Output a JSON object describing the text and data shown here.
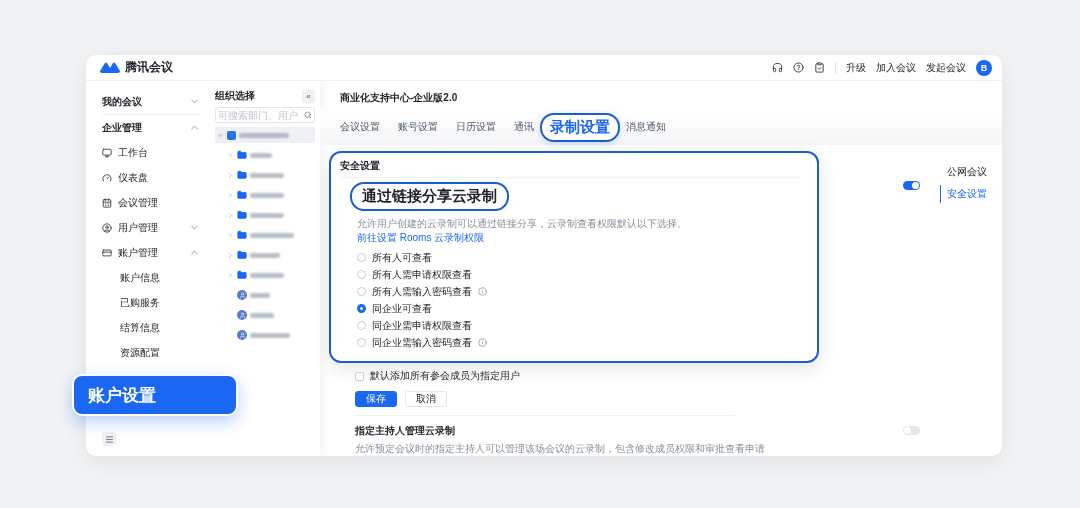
{
  "app": {
    "name": "腾讯会议"
  },
  "header": {
    "actions": [
      "升级",
      "加入会议",
      "发起会议"
    ],
    "avatar": "B"
  },
  "sidebar": {
    "items": [
      {
        "label": "我的会议",
        "expanded": false
      },
      {
        "label": "企业管理",
        "expanded": true,
        "children": [
          {
            "label": "工作台"
          },
          {
            "label": "仪表盘"
          },
          {
            "label": "会议管理"
          },
          {
            "label": "用户管理",
            "expanded": false
          },
          {
            "label": "账户管理",
            "expanded": true,
            "children": [
              {
                "label": "账户信息"
              },
              {
                "label": "已购服务"
              },
              {
                "label": "结算信息"
              },
              {
                "label": "资源配置"
              }
            ]
          }
        ]
      }
    ]
  },
  "org_panel": {
    "title": "组织选择",
    "collapse": "«",
    "search": {
      "placeholder": "可搜索部门、用户"
    },
    "tree": {
      "expanded": true,
      "selected": true,
      "children": [
        {
          "kind": "folder",
          "expanded": false
        },
        {
          "kind": "folder",
          "expanded": false
        },
        {
          "kind": "folder",
          "expanded": false
        },
        {
          "kind": "folder",
          "expanded": false
        },
        {
          "kind": "folder",
          "expanded": false
        },
        {
          "kind": "folder",
          "expanded": false
        },
        {
          "kind": "folder",
          "expanded": false
        },
        {
          "kind": "person"
        },
        {
          "kind": "person"
        },
        {
          "kind": "person"
        }
      ]
    }
  },
  "callout": {
    "label": "账户设置"
  },
  "main": {
    "title": "商业化支持中心-企业版2.0",
    "tabs": [
      {
        "label": "会议设置",
        "selected": false
      },
      {
        "label": "账号设置",
        "selected": false
      },
      {
        "label": "日历设置",
        "selected": false
      },
      {
        "label": "通讯",
        "selected": false
      },
      {
        "label": "录制设置",
        "selected": true
      },
      {
        "label": "消息通知",
        "selected": false
      }
    ],
    "section": {
      "title": "安全设置",
      "setting": {
        "title": "通过链接分享云录制",
        "on": true,
        "description": "允许用户创建的云录制可以通过链接分享，云录制查看权限默认以下选择。",
        "link": "前往设置 Rooms 云录制权限",
        "options": [
          {
            "label": "所有人可查看",
            "selected": false,
            "info": false
          },
          {
            "label": "所有人需申请权限查看",
            "selected": false,
            "info": false
          },
          {
            "label": "所有人需输入密码查看",
            "selected": false,
            "info": true
          },
          {
            "label": "同企业可查看",
            "selected": true,
            "info": false
          },
          {
            "label": "同企业需申请权限查看",
            "selected": false,
            "info": false
          },
          {
            "label": "同企业需输入密码查看",
            "selected": false,
            "info": true
          }
        ]
      },
      "checkbox": {
        "label": "默认添加所有参会成员为指定用户",
        "checked": false
      },
      "buttons": [
        {
          "label": "保存",
          "kind": "primary"
        },
        {
          "label": "取消",
          "kind": "secondary"
        }
      ],
      "host_setting": {
        "title": "指定主持人管理云录制",
        "description": "允许预定会议时的指定主持人可以管理该场会议的云录制，包含修改成员权限和审批查看申请",
        "on": false
      }
    },
    "right_nav": [
      {
        "label": "公网会议",
        "selected": false
      },
      {
        "label": "安全设置",
        "selected": true
      }
    ]
  }
}
